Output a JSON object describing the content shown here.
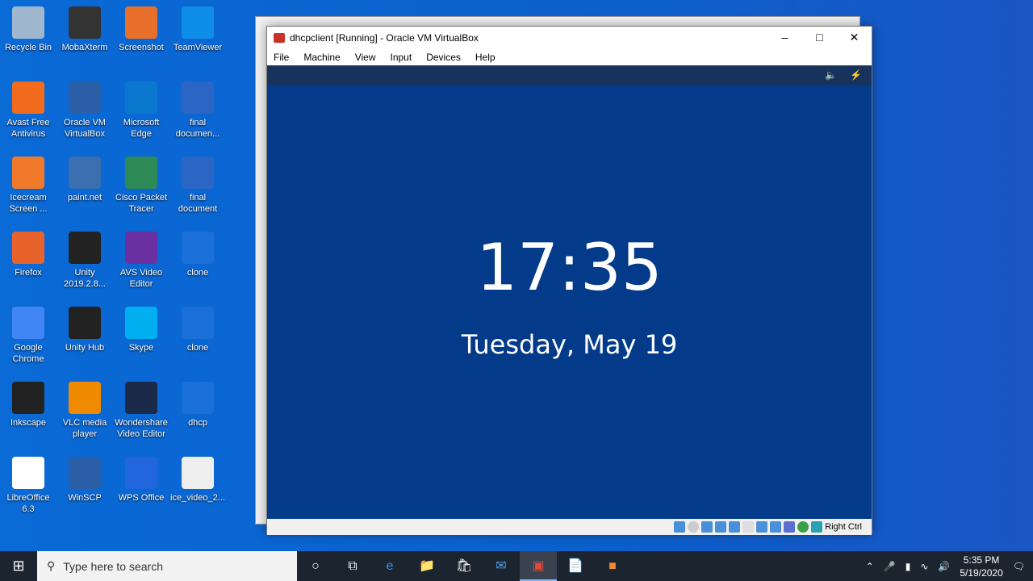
{
  "desktop": {
    "icons": [
      [
        "Recycle Bin",
        "MobaXterm",
        "Screenshot",
        "TeamViewer"
      ],
      [
        "Avast Free Antivirus",
        "Oracle VM VirtualBox",
        "Microsoft Edge",
        "final documen..."
      ],
      [
        "Icecream Screen ...",
        "paint.net",
        "Cisco Packet Tracer",
        "final document"
      ],
      [
        "Firefox",
        "Unity 2019.2.8...",
        "AVS Video Editor",
        "clone"
      ],
      [
        "Google Chrome",
        "Unity Hub",
        "Skype",
        "clone"
      ],
      [
        "Inkscape",
        "VLC media player",
        "Wondershare Video Editor",
        "dhcp"
      ],
      [
        "LibreOffice 6.3",
        "WinSCP",
        "WPS Office",
        "ice_video_2..."
      ]
    ],
    "colors": [
      [
        "#9fb8d0",
        "#333",
        "#e8702a",
        "#0e8ee9"
      ],
      [
        "#f26b1d",
        "#2b5fa8",
        "#0b78d0",
        "#2b66c4"
      ],
      [
        "#f07a2a",
        "#3a6fb0",
        "#2e8b57",
        "#2b66c4"
      ],
      [
        "#e8632b",
        "#222",
        "#6a2fa0",
        "#1a6fd8"
      ],
      [
        "#4285f4",
        "#222",
        "#00aff0",
        "#1a6fd8"
      ],
      [
        "#222",
        "#f08a00",
        "#1c2a4a",
        "#1a6fd8"
      ],
      [
        "#fff",
        "#2b5fa8",
        "#2266dd",
        "#eee"
      ]
    ]
  },
  "vbox": {
    "title": "dhcpclient [Running] - Oracle VM VirtualBox",
    "menu": [
      "File",
      "Machine",
      "View",
      "Input",
      "Devices",
      "Help"
    ],
    "clock": "17:35",
    "date": "Tuesday, May 19",
    "host_key": "Right Ctrl"
  },
  "taskbar": {
    "search_placeholder": "Type here to search",
    "time": "5:35 PM",
    "date": "5/19/2020"
  }
}
